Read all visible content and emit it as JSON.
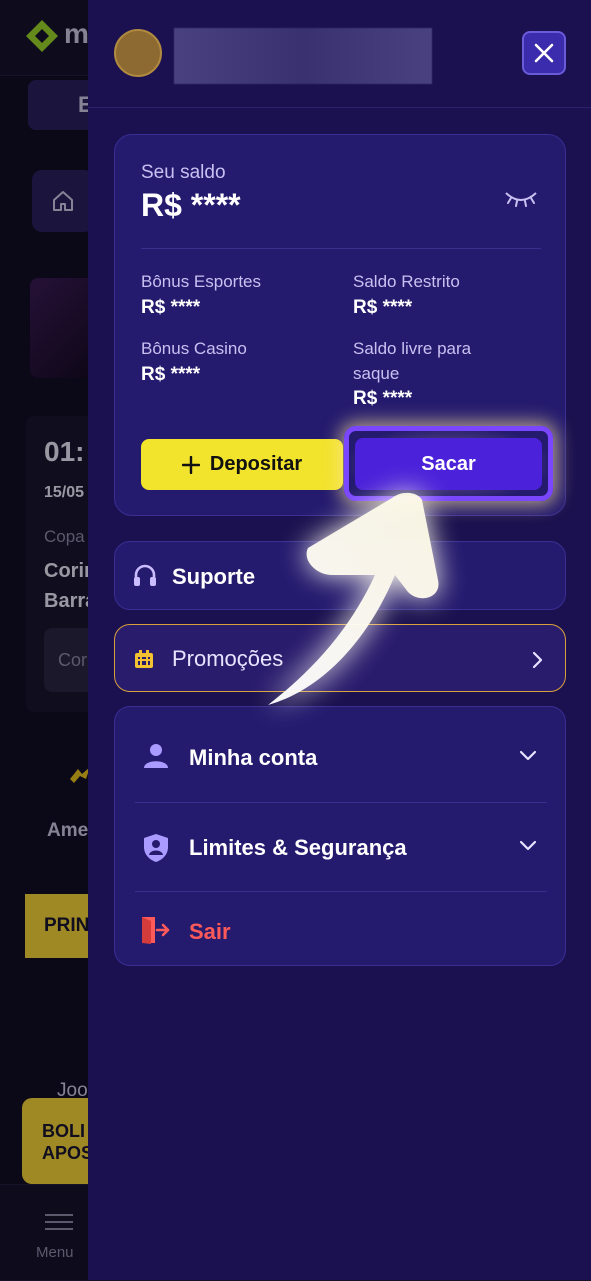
{
  "background": {
    "logo_text": "m",
    "tab_label": "E",
    "match_time": "01:",
    "match_date": "15/05",
    "league": "Copa",
    "team1": "Corin",
    "team2": "Barra",
    "odd": "Cor",
    "team_label": "Ame",
    "promo_label": "PRIN",
    "game_label": "Joo",
    "bolao_label_1": "BOLI",
    "bolao_label_2": "APOS",
    "bottom_menu_label": "Menu"
  },
  "drawer": {
    "balance": {
      "label": "Seu saldo",
      "value": "R$ ****",
      "items": [
        {
          "label": "Bônus Esportes",
          "value": "R$ ****"
        },
        {
          "label": "Saldo Restrito",
          "value": "R$ ****"
        },
        {
          "label": "Bônus Casino",
          "value": "R$ ****"
        },
        {
          "label_line1": "Saldo livre para",
          "label_line2": "saque",
          "value": "R$ ****"
        }
      ],
      "deposit_label": "Depositar",
      "withdraw_label": "Sacar"
    },
    "support_label": "Suporte",
    "promotions_label": "Promoções",
    "account": {
      "my_account": "Minha conta",
      "limits": "Limites & Segurança",
      "logout": "Sair"
    }
  },
  "colors": {
    "drawer_bg": "#1b1150",
    "card_bg": "#241a6e",
    "deposit": "#f2e32c",
    "withdraw": "#4b21d9",
    "logout": "#ff5a5a",
    "promo_border": "#d9a13a"
  }
}
